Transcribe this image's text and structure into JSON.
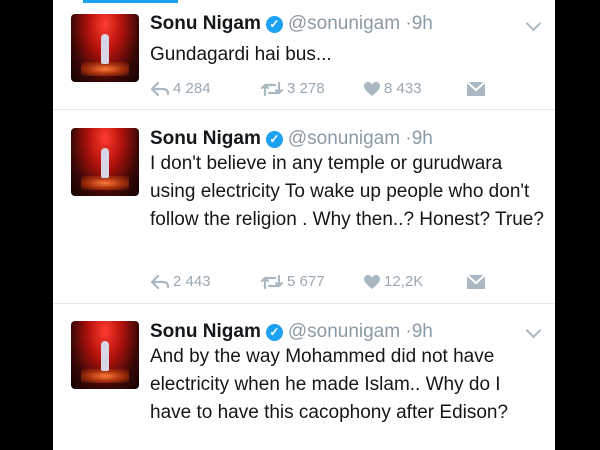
{
  "tweets": [
    {
      "author": "Sonu Nigam",
      "handle": "@sonunigam",
      "separator": "·",
      "time": "9h",
      "text": "Gundagardi hai bus...",
      "replies": "4 284",
      "retweets": "3 278",
      "likes": "8 433"
    },
    {
      "author": "Sonu Nigam",
      "handle": "@sonunigam",
      "separator": "·",
      "time": "9h",
      "text": "I don't believe in any temple or gurudwara using electricity To wake up people who don't follow the religion . Why then..? Honest? True?",
      "replies": "2 443",
      "retweets": "5 677",
      "likes": "12,2K"
    },
    {
      "author": "Sonu Nigam",
      "handle": "@sonunigam",
      "separator": "·",
      "time": "9h",
      "text": "And by the way Mohammed did not have electricity when he made Islam.. Why do I have to have this cacophony after Edison?"
    }
  ],
  "colors": {
    "accent": "#1da1f2",
    "text": "#14171a",
    "muted": "#8a9aa6",
    "background": "#ffffff"
  },
  "icons": [
    "reply-icon",
    "retweet-icon",
    "like-icon",
    "direct-message-icon",
    "verified-badge-icon",
    "chevron-down-icon"
  ]
}
